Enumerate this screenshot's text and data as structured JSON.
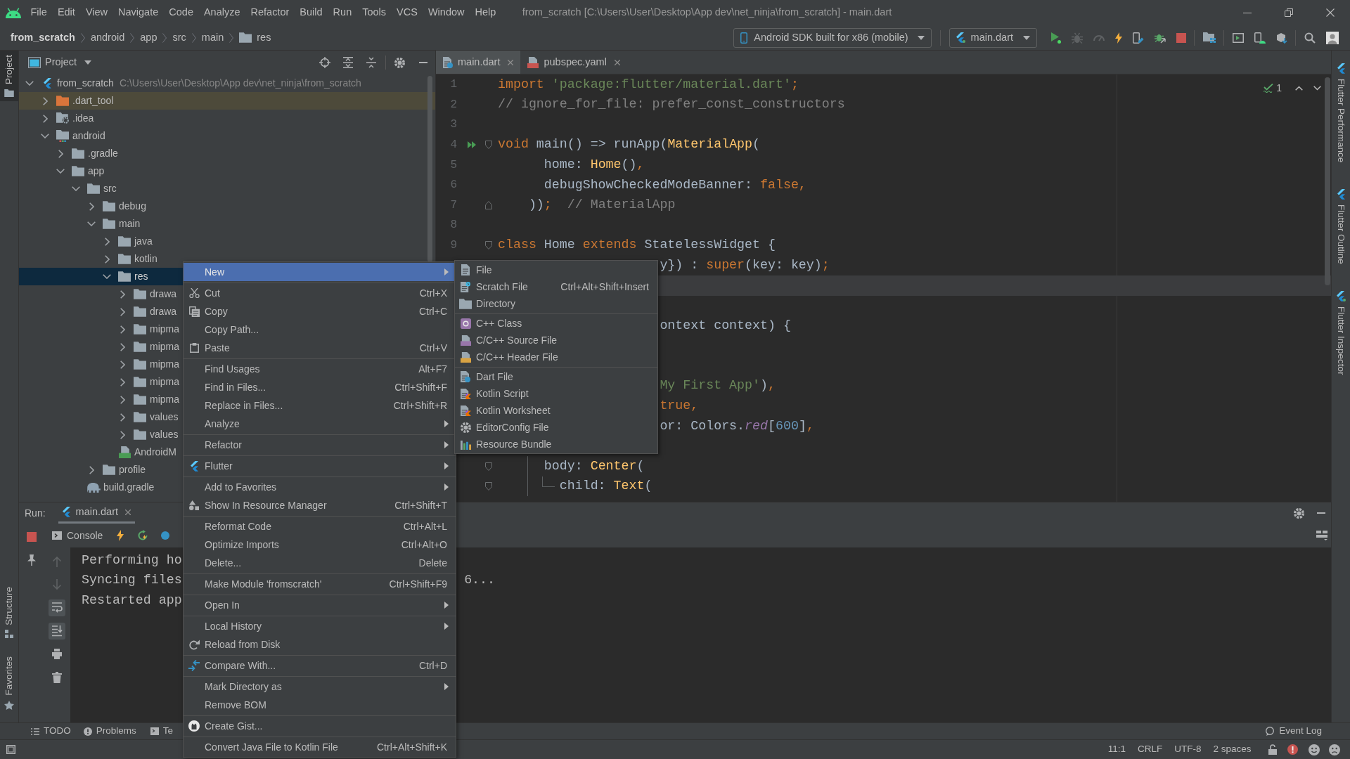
{
  "menu_bar": {
    "items": [
      {
        "label": "File"
      },
      {
        "label": "Edit"
      },
      {
        "label": "View"
      },
      {
        "label": "Navigate"
      },
      {
        "label": "Code"
      },
      {
        "label": "Analyze"
      },
      {
        "label": "Refactor"
      },
      {
        "label": "Build"
      },
      {
        "label": "Run"
      },
      {
        "label": "Tools"
      },
      {
        "label": "VCS"
      },
      {
        "label": "Window"
      },
      {
        "label": "Help"
      }
    ],
    "title": "from_scratch [C:\\Users\\User\\Desktop\\App dev\\net_ninja\\from_scratch] - main.dart"
  },
  "navigation_bar": {
    "breadcrumbs": [
      {
        "label": "from_scratch",
        "kind": "project"
      },
      {
        "label": "android",
        "kind": "plain"
      },
      {
        "label": "app",
        "kind": "plain"
      },
      {
        "label": "src",
        "kind": "plain"
      },
      {
        "label": "main",
        "kind": "plain"
      },
      {
        "label": "res",
        "kind": "folder"
      }
    ],
    "device": "Android SDK built for x86 (mobile)",
    "run_configuration": "main.dart",
    "action_groups": [
      {
        "actions": [
          {
            "kind": "run",
            "disabled": false
          },
          {
            "kind": "debug",
            "disabled": true
          },
          {
            "kind": "profile",
            "disabled": true
          },
          {
            "kind": "hot_reload",
            "disabled": false
          },
          {
            "kind": "device_file",
            "disabled": false
          },
          {
            "kind": "attach_debugger",
            "disabled": false
          },
          {
            "kind": "stop",
            "disabled": false
          }
        ]
      },
      {
        "actions": [
          {
            "kind": "project_structure",
            "disabled": false
          }
        ]
      },
      {
        "actions": [
          {
            "kind": "terminal",
            "disabled": false
          },
          {
            "kind": "device_manager",
            "disabled": false
          },
          {
            "kind": "sdk_manager",
            "disabled": false
          }
        ]
      },
      {
        "actions": [
          {
            "kind": "search",
            "disabled": false
          },
          {
            "kind": "account",
            "disabled": false
          }
        ]
      }
    ]
  },
  "tool_window_stripes": {
    "left_top": [
      {
        "label": "Project",
        "selected": true
      }
    ],
    "left_bottom": [
      {
        "label": "Structure",
        "selected": false
      },
      {
        "label": "Favorites",
        "selected": false
      }
    ],
    "right": [
      {
        "label": "Flutter Performance",
        "selected": false
      },
      {
        "label": "Flutter Outline",
        "selected": false
      },
      {
        "label": "Flutter Inspector",
        "selected": false
      }
    ]
  },
  "project_panel": {
    "title": "Project",
    "tree": [
      {
        "label": "from_scratch",
        "kind": "project",
        "path": "C:\\Users\\User\\Desktop\\App dev\\net_ninja\\from_scratch",
        "expanded": true,
        "selected": false,
        "children": [
          {
            "label": ".dart_tool",
            "kind": "excluded_folder",
            "expanded": false,
            "selected": false
          },
          {
            "label": ".idea",
            "kind": "config_folder",
            "expanded": false,
            "selected": false
          },
          {
            "label": "android",
            "kind": "module_folder",
            "expanded": true,
            "selected": false,
            "children": [
              {
                "label": ".gradle",
                "kind": "folder",
                "expanded": false,
                "selected": false
              },
              {
                "label": "app",
                "kind": "folder",
                "expanded": true,
                "selected": false,
                "children": [
                  {
                    "label": "src",
                    "kind": "folder",
                    "expanded": true,
                    "selected": false,
                    "children": [
                      {
                        "label": "debug",
                        "kind": "folder",
                        "expanded": false,
                        "selected": false
                      },
                      {
                        "label": "main",
                        "kind": "folder",
                        "expanded": true,
                        "selected": false,
                        "children": [
                          {
                            "label": "java",
                            "kind": "folder",
                            "expanded": false,
                            "selected": false
                          },
                          {
                            "label": "kotlin",
                            "kind": "folder",
                            "expanded": false,
                            "selected": false
                          },
                          {
                            "label": "res",
                            "kind": "folder",
                            "expanded": true,
                            "selected": true,
                            "children": [
                              {
                                "label": "drawa",
                                "kind": "folder",
                                "expanded": false,
                                "selected": false
                              },
                              {
                                "label": "drawa",
                                "kind": "folder",
                                "expanded": false,
                                "selected": false
                              },
                              {
                                "label": "mipma",
                                "kind": "folder",
                                "expanded": false,
                                "selected": false
                              },
                              {
                                "label": "mipma",
                                "kind": "folder",
                                "expanded": false,
                                "selected": false
                              },
                              {
                                "label": "mipma",
                                "kind": "folder",
                                "expanded": false,
                                "selected": false
                              },
                              {
                                "label": "mipma",
                                "kind": "folder",
                                "expanded": false,
                                "selected": false
                              },
                              {
                                "label": "mipma",
                                "kind": "folder",
                                "expanded": false,
                                "selected": false
                              },
                              {
                                "label": "values",
                                "kind": "folder",
                                "expanded": false,
                                "selected": false
                              },
                              {
                                "label": "values",
                                "kind": "folder",
                                "expanded": false,
                                "selected": false
                              }
                            ]
                          },
                          {
                            "label": "AndroidM",
                            "kind": "manifest_file",
                            "selected": false
                          }
                        ]
                      },
                      {
                        "label": "profile",
                        "kind": "folder",
                        "expanded": false,
                        "selected": false
                      }
                    ]
                  },
                  {
                    "label": "build.gradle",
                    "kind": "gradle_file",
                    "selected": false
                  }
                ]
              }
            ]
          }
        ]
      }
    ]
  },
  "editor": {
    "tabs": [
      {
        "label": "main.dart",
        "kind": "dart",
        "selected": true
      },
      {
        "label": "pubspec.yaml",
        "kind": "yaml",
        "selected": false
      }
    ],
    "problem_count": "1",
    "lines": [
      {
        "number": "1",
        "current": false,
        "kind": "full",
        "tokens": [
          {
            "kind": "keyword",
            "text": "import"
          },
          {
            "kind": "string",
            "text": " 'package:flutter/material.dart'"
          },
          {
            "kind": "keyword",
            "text": ";"
          }
        ]
      },
      {
        "number": "2",
        "current": false,
        "kind": "full",
        "tokens": [
          {
            "kind": "comment",
            "text": "// ignore_for_file: prefer_const_constructors"
          }
        ]
      },
      {
        "number": "3",
        "current": false
      },
      {
        "number": "4",
        "current": false,
        "markers": [
          {
            "kind": "run"
          },
          {
            "kind": "fold_start"
          }
        ],
        "kind": "full",
        "tokens": [
          {
            "kind": "keyword",
            "text": "void"
          },
          {
            "kind": "plain",
            "text": " main() => runApp("
          },
          {
            "kind": "call",
            "text": "MaterialApp"
          },
          {
            "kind": "plain",
            "text": "("
          }
        ]
      },
      {
        "number": "5",
        "current": false,
        "kind": "full",
        "tokens": [
          {
            "kind": "plain",
            "text": "      home: "
          },
          {
            "kind": "call",
            "text": "Home"
          },
          {
            "kind": "plain",
            "text": "()"
          },
          {
            "kind": "keyword",
            "text": ","
          }
        ]
      },
      {
        "number": "6",
        "current": false,
        "kind": "full",
        "tokens": [
          {
            "kind": "plain",
            "text": "      debugShowCheckedModeBanner: "
          },
          {
            "kind": "keyword",
            "text": "false,"
          }
        ]
      },
      {
        "number": "7",
        "current": false,
        "markers": [
          {
            "kind": "fold_end"
          }
        ],
        "kind": "full",
        "tokens": [
          {
            "kind": "plain",
            "text": "    ))"
          },
          {
            "kind": "keyword",
            "text": ";"
          },
          {
            "kind": "comment",
            "text": "  // MaterialApp"
          }
        ]
      },
      {
        "number": "8",
        "current": false
      },
      {
        "number": "9",
        "current": false,
        "markers": [
          {
            "kind": "fold_start"
          }
        ],
        "kind": "full",
        "tokens": [
          {
            "kind": "keyword",
            "text": "class"
          },
          {
            "kind": "plain",
            "text": " Home "
          },
          {
            "kind": "keyword",
            "text": "extends"
          },
          {
            "kind": "plain",
            "text": " StatelessWidget {"
          }
        ]
      },
      {
        "current": false,
        "kind": "fragment",
        "tokens": [
          {
            "kind": "plain",
            "text": "y}) : "
          },
          {
            "kind": "keyword",
            "text": "super"
          },
          {
            "kind": "plain",
            "text": "(key: key)"
          },
          {
            "kind": "keyword",
            "text": ";"
          }
        ]
      },
      {
        "current": true
      },
      {
        "current": false
      },
      {
        "current": false,
        "kind": "fragment",
        "tokens": [
          {
            "kind": "plain",
            "text": "ontext context) {"
          }
        ]
      },
      {
        "current": false
      },
      {
        "current": false
      },
      {
        "current": false,
        "kind": "fragment",
        "tokens": [
          {
            "kind": "string",
            "text": "My First App'"
          },
          {
            "kind": "plain",
            "text": ")"
          },
          {
            "kind": "keyword",
            "text": ","
          }
        ]
      },
      {
        "current": false,
        "kind": "fragment",
        "tokens": [
          {
            "kind": "keyword",
            "text": "true,"
          }
        ]
      },
      {
        "current": false,
        "kind": "fragment",
        "tokens": [
          {
            "kind": "plain",
            "text": "or: Colors."
          },
          {
            "kind": "field",
            "text": "red"
          },
          {
            "kind": "plain",
            "text": "["
          },
          {
            "kind": "number",
            "text": "600"
          },
          {
            "kind": "plain",
            "text": "]"
          },
          {
            "kind": "keyword",
            "text": ","
          }
        ]
      },
      {
        "current": false
      },
      {
        "current": false,
        "markers": [
          {
            "kind": "fold_start"
          }
        ],
        "guides": [
          {
            "kind": "line"
          }
        ],
        "kind": "full",
        "tokens": [
          {
            "kind": "plain",
            "text": "      body: "
          },
          {
            "kind": "call",
            "text": "Center"
          },
          {
            "kind": "plain",
            "text": "("
          }
        ]
      },
      {
        "current": false,
        "markers": [
          {
            "kind": "fold_start"
          }
        ],
        "guides": [
          {
            "kind": "line"
          },
          {
            "kind": "branch"
          }
        ],
        "kind": "full",
        "tokens": [
          {
            "kind": "plain",
            "text": "        child: "
          },
          {
            "kind": "call",
            "text": "Text"
          },
          {
            "kind": "plain",
            "text": "("
          }
        ]
      }
    ]
  },
  "run_panel": {
    "title": "Run:",
    "tabs": [
      {
        "label": "main.dart",
        "selected": true
      }
    ],
    "console_tab": "Console",
    "console_actions": [
      {
        "kind": "previous",
        "disabled": true,
        "on": false
      },
      {
        "kind": "next",
        "disabled": true,
        "on": false
      },
      {
        "kind": "soft_wrap",
        "disabled": false,
        "on": true
      },
      {
        "kind": "scroll_to_end",
        "disabled": false,
        "on": true
      },
      {
        "kind": "print",
        "disabled": false,
        "on": false
      },
      {
        "kind": "clear",
        "disabled": false,
        "on": false
      }
    ],
    "lines": [
      {
        "text": "Performing ho"
      },
      {
        "text": "Syncing files",
        "continuation": "6..."
      },
      {
        "text": "Restarted app"
      }
    ]
  },
  "bottom_bar": {
    "tool_windows": [
      {
        "label": "TODO",
        "kind": "todo"
      },
      {
        "label": "Problems",
        "kind": "problems"
      },
      {
        "label": "Te",
        "kind": "terminal"
      }
    ],
    "event_log": "Event Log"
  },
  "status_bar": {
    "items": [
      "11:1",
      "CRLF",
      "UTF-8",
      "2 spaces"
    ]
  },
  "context_menu": {
    "groups": [
      {
        "items": [
          {
            "label": "New",
            "kind": "submenu",
            "selected": true
          }
        ]
      },
      {
        "items": [
          {
            "label": "Cut",
            "kind": "action",
            "selected": false,
            "shortcut": "Ctrl+X"
          },
          {
            "label": "Copy",
            "kind": "action",
            "selected": false,
            "shortcut": "Ctrl+C"
          },
          {
            "label": "Copy Path...",
            "kind": "action",
            "selected": false
          },
          {
            "label": "Paste",
            "kind": "action",
            "selected": false,
            "shortcut": "Ctrl+V"
          }
        ]
      },
      {
        "items": [
          {
            "label": "Find Usages",
            "kind": "action",
            "selected": false,
            "shortcut": "Alt+F7"
          },
          {
            "label": "Find in Files...",
            "kind": "action",
            "selected": false,
            "shortcut": "Ctrl+Shift+F"
          },
          {
            "label": "Replace in Files...",
            "kind": "action",
            "selected": false,
            "shortcut": "Ctrl+Shift+R"
          },
          {
            "label": "Analyze",
            "kind": "submenu",
            "selected": false
          }
        ]
      },
      {
        "items": [
          {
            "label": "Refactor",
            "kind": "submenu",
            "selected": false
          }
        ]
      },
      {
        "items": [
          {
            "label": "Flutter",
            "kind": "submenu",
            "selected": false
          }
        ]
      },
      {
        "items": [
          {
            "label": "Add to Favorites",
            "kind": "submenu",
            "selected": false
          },
          {
            "label": "Show In Resource Manager",
            "kind": "action",
            "selected": false,
            "shortcut": "Ctrl+Shift+T"
          }
        ]
      },
      {
        "items": [
          {
            "label": "Reformat Code",
            "kind": "action",
            "selected": false,
            "shortcut": "Ctrl+Alt+L"
          },
          {
            "label": "Optimize Imports",
            "kind": "action",
            "selected": false,
            "shortcut": "Ctrl+Alt+O"
          },
          {
            "label": "Delete...",
            "kind": "action",
            "selected": false,
            "shortcut": "Delete"
          }
        ]
      },
      {
        "items": [
          {
            "label": "Make Module 'fromscratch'",
            "kind": "action",
            "selected": false,
            "shortcut": "Ctrl+Shift+F9"
          }
        ]
      },
      {
        "items": [
          {
            "label": "Open In",
            "kind": "submenu",
            "selected": false
          }
        ]
      },
      {
        "items": [
          {
            "label": "Local History",
            "kind": "submenu",
            "selected": false
          },
          {
            "label": "Reload from Disk",
            "kind": "action",
            "selected": false
          }
        ]
      },
      {
        "items": [
          {
            "label": "Compare With...",
            "kind": "action",
            "selected": false,
            "shortcut": "Ctrl+D"
          }
        ]
      },
      {
        "items": [
          {
            "label": "Mark Directory as",
            "kind": "submenu",
            "selected": false
          },
          {
            "label": "Remove BOM",
            "kind": "action",
            "selected": false
          }
        ]
      },
      {
        "items": [
          {
            "label": "Create Gist...",
            "kind": "action",
            "selected": false
          }
        ]
      },
      {
        "items": [
          {
            "label": "Convert Java File to Kotlin File",
            "kind": "action",
            "selected": false,
            "shortcut": "Ctrl+Alt+Shift+K"
          }
        ]
      }
    ]
  },
  "new_submenu": {
    "groups": [
      {
        "items": [
          {
            "label": "File",
            "selected": false
          },
          {
            "label": "Scratch File",
            "selected": false,
            "shortcut": "Ctrl+Alt+Shift+Insert"
          },
          {
            "label": "Directory",
            "selected": false
          }
        ]
      },
      {
        "items": [
          {
            "label": "C++ Class",
            "selected": false
          },
          {
            "label": "C/C++ Source File",
            "selected": false
          },
          {
            "label": "C/C++ Header File",
            "selected": false
          }
        ]
      },
      {
        "items": [
          {
            "label": "Dart File",
            "selected": false
          },
          {
            "label": "Kotlin Script",
            "selected": false
          },
          {
            "label": "Kotlin Worksheet",
            "selected": false
          },
          {
            "label": "EditorConfig File",
            "selected": false
          },
          {
            "label": "Resource Bundle",
            "selected": false
          }
        ]
      }
    ]
  }
}
